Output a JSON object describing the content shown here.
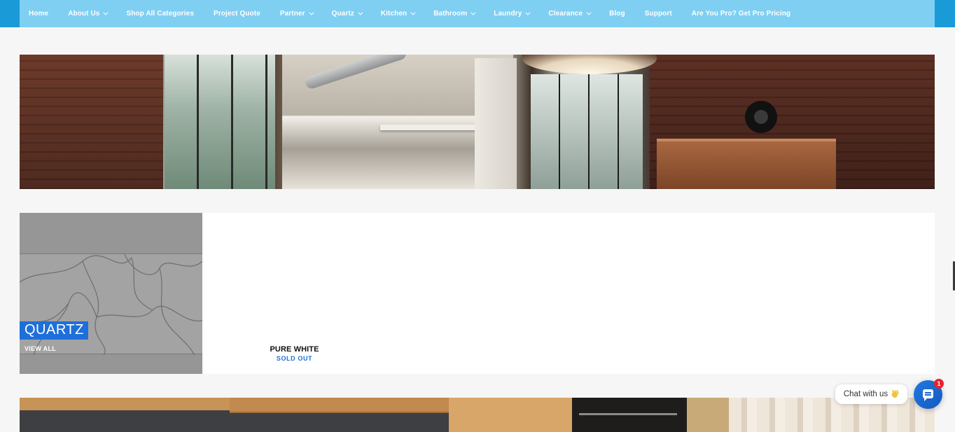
{
  "nav": {
    "items": [
      {
        "label": "Home",
        "dropdown": false
      },
      {
        "label": "About Us",
        "dropdown": true
      },
      {
        "label": "Shop All Categories",
        "dropdown": false
      },
      {
        "label": "Project Quote",
        "dropdown": false
      },
      {
        "label": "Partner",
        "dropdown": true
      },
      {
        "label": "Quartz",
        "dropdown": true
      },
      {
        "label": "Kitchen",
        "dropdown": true
      },
      {
        "label": "Bathroom",
        "dropdown": true
      },
      {
        "label": "Laundry",
        "dropdown": true
      },
      {
        "label": "Clearance",
        "dropdown": true
      },
      {
        "label": "Blog",
        "dropdown": false
      },
      {
        "label": "Support",
        "dropdown": false
      },
      {
        "label": "Are You Pro? Get Pro Pricing",
        "dropdown": false
      }
    ]
  },
  "category": {
    "title": "QUARTZ",
    "view_all": "VIEW ALL"
  },
  "product": {
    "name": "PURE WHITE",
    "status": "SOLD OUT"
  },
  "chat": {
    "prompt": "Chat with us",
    "prompt_icon": "waving-hand-icon",
    "button_icon": "chat-bubble-icon",
    "unread_count": "1"
  },
  "colors": {
    "nav_background": "#7fcff3",
    "nav_edge": "#1a9ad6",
    "accent_blue": "#1e6fd9",
    "badge_red": "#e8222d"
  }
}
